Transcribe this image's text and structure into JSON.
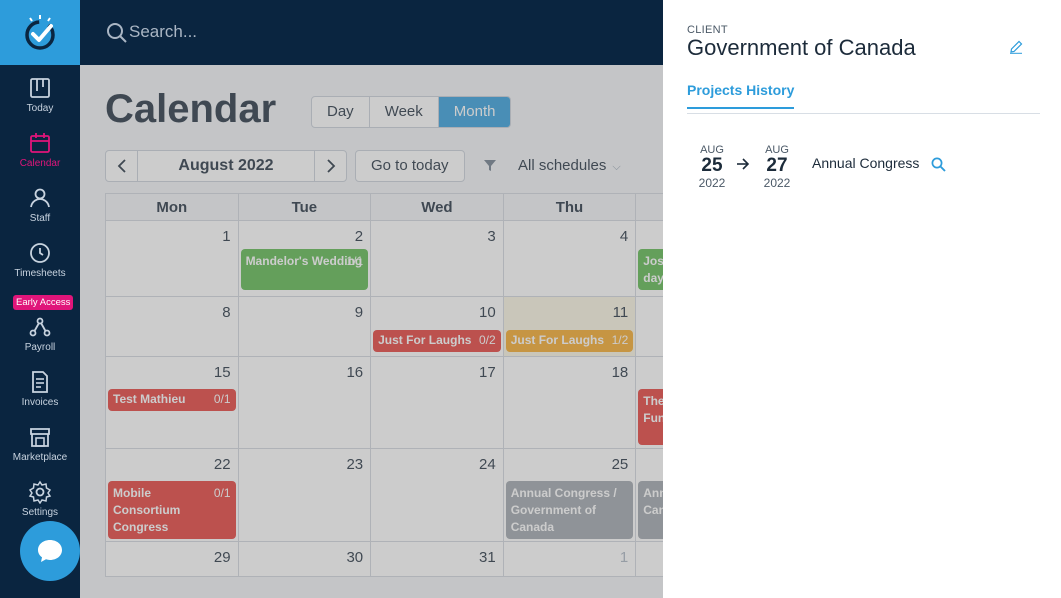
{
  "sidebar": {
    "items": [
      {
        "label": "Today",
        "icon": "board-icon"
      },
      {
        "label": "Calendar",
        "icon": "calendar-icon"
      },
      {
        "label": "Staff",
        "icon": "staff-icon"
      },
      {
        "label": "Timesheets",
        "icon": "clock-icon"
      },
      {
        "label": "Payroll",
        "icon": "payroll-icon"
      },
      {
        "label": "Invoices",
        "icon": "invoice-icon"
      },
      {
        "label": "Marketplace",
        "icon": "store-icon"
      },
      {
        "label": "Settings",
        "icon": "gear-icon"
      }
    ],
    "early_access": "Early Access",
    "active": "Calendar"
  },
  "search": {
    "placeholder": "Search..."
  },
  "calendar": {
    "title": "Calendar",
    "views": [
      "Day",
      "Week",
      "Month"
    ],
    "active_view": "Month",
    "month_label": "August 2022",
    "today_button": "Go to today",
    "schedules": "All schedules",
    "weekdays": [
      "Mon",
      "Tue",
      "Wed",
      "Thu"
    ],
    "weeks": [
      {
        "days": [
          "1",
          "2",
          "3",
          "4"
        ]
      },
      {
        "days": [
          "8",
          "9",
          "10",
          "11"
        ]
      },
      {
        "days": [
          "15",
          "16",
          "17",
          "18"
        ]
      },
      {
        "days": [
          "22",
          "23",
          "24",
          "25"
        ]
      },
      {
        "days": [
          "29",
          "30",
          "31",
          "1"
        ]
      }
    ],
    "events": [
      {
        "title": "Mandelor's Wedding",
        "count": "1/1",
        "color": "#58b74a"
      },
      {
        "title": "Josh day",
        "count": "",
        "color": "#58b74a"
      },
      {
        "title": "Just For Laughs",
        "count": "0/2",
        "color": "#e53935"
      },
      {
        "title": "Just For Laughs",
        "count": "1/2",
        "color": "#f5a623"
      },
      {
        "title": "Test Mathieu",
        "count": "0/1",
        "color": "#e53935"
      },
      {
        "title": "The Ann Fun",
        "count": "",
        "color": "#e53935"
      },
      {
        "title": "Mobile Consortium Congress",
        "count": "0/1",
        "color": "#e53935"
      },
      {
        "title": "Annual Congress / Government of Canada",
        "count": "",
        "color": "#9da4ab"
      },
      {
        "title": "Ann Gov Can",
        "count": "",
        "color": "#9da4ab"
      }
    ]
  },
  "panel": {
    "client_label": "CLIENT",
    "client_name": "Government of Canada",
    "tab": "Projects History",
    "projects": [
      {
        "start": {
          "month": "AUG",
          "day": "25",
          "year": "2022"
        },
        "end": {
          "month": "AUG",
          "day": "27",
          "year": "2022"
        },
        "name": "Annual Congress"
      }
    ]
  }
}
